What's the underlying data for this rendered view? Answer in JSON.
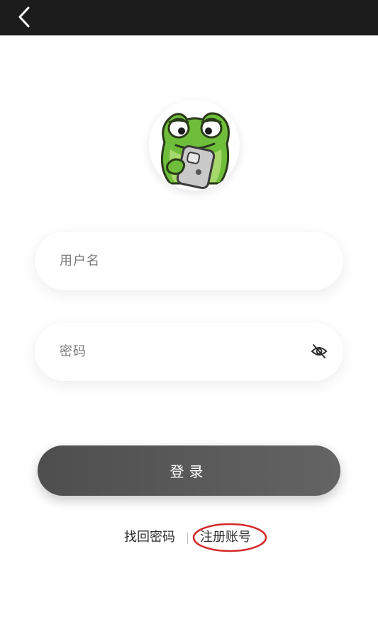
{
  "header": {
    "back_icon": "chevron-left-icon",
    "background": "#1c1c1c"
  },
  "logo": {
    "icon": "frog-mascot-icon"
  },
  "form": {
    "username_placeholder": "用户名",
    "password_placeholder": "密码",
    "password_toggle_icon": "eye-slash-icon"
  },
  "login_button": {
    "label": "登录"
  },
  "links": {
    "forgot_password": "找回密码",
    "separator": "|",
    "register": "注册账号"
  },
  "annotation": {
    "color": "#d42a2a",
    "shape": "ellipse"
  }
}
